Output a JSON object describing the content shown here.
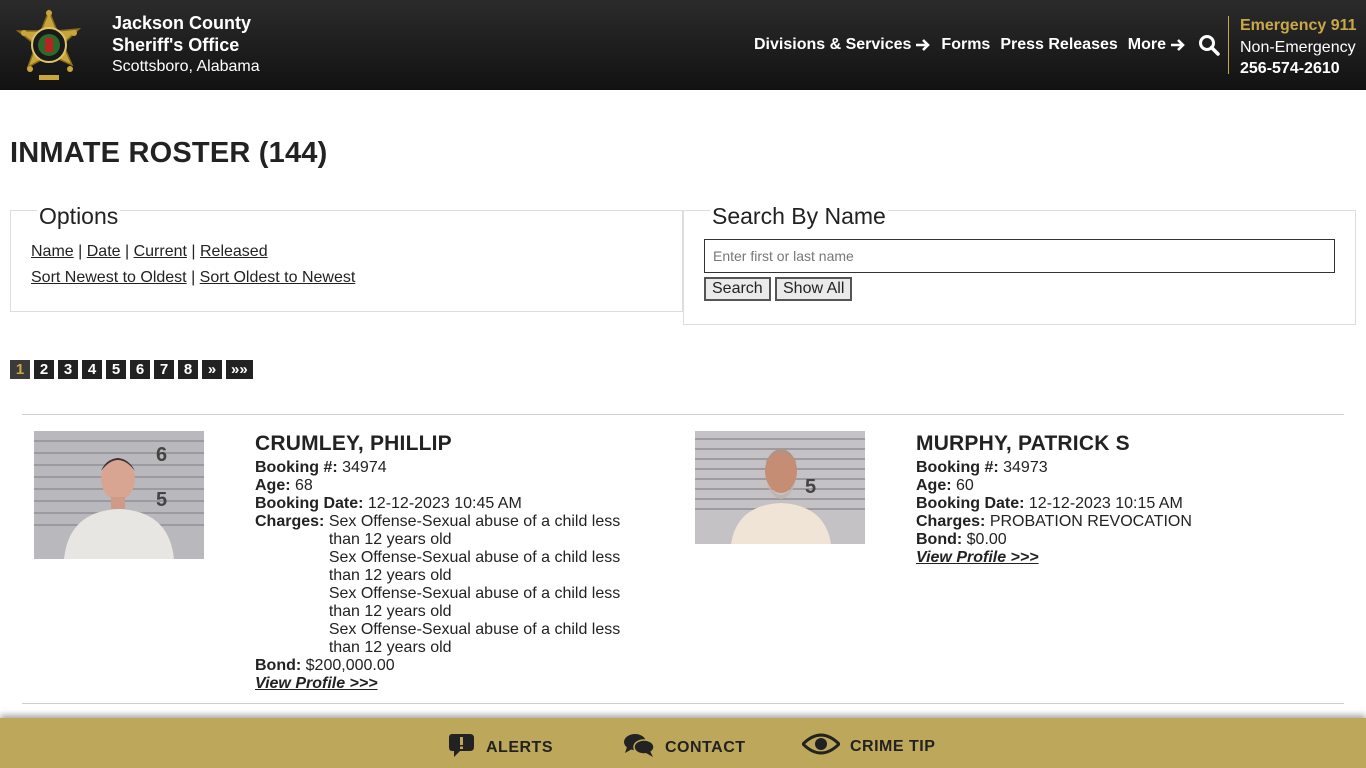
{
  "header": {
    "org_line1": "Jackson County",
    "org_line2": "Sheriff's Office",
    "location": "Scottsboro, Alabama",
    "nav": [
      {
        "label": "Divisions & Services",
        "icon": "arrow-right-icon"
      },
      {
        "label": "Forms"
      },
      {
        "label": "Press Releases"
      },
      {
        "label": "More",
        "icon": "arrow-right-icon"
      }
    ],
    "search_icon": "search-icon",
    "emergency_label": "Emergency 911",
    "non_emergency_label": "Non-Emergency",
    "non_emergency_phone": "256-574-2610",
    "accent_color": "#c9a84a"
  },
  "page": {
    "title": "INMATE ROSTER (144)"
  },
  "options": {
    "legend": "Options",
    "sort_links": [
      "Name",
      "Date",
      "Current",
      "Released"
    ],
    "order_links": [
      "Sort Newest to Oldest",
      "Sort Oldest to Newest"
    ]
  },
  "search": {
    "legend": "Search By Name",
    "placeholder": "Enter first or last name",
    "value": "",
    "search_button": "Search",
    "show_all_button": "Show All"
  },
  "pagination": {
    "pages": [
      "1",
      "2",
      "3",
      "4",
      "5",
      "6",
      "7",
      "8",
      "»",
      "»»"
    ],
    "current": "1"
  },
  "inmates": [
    {
      "name": "CRUMLEY, PHILLIP",
      "booking_label": "Booking #:",
      "booking_number": "34974",
      "age_label": "Age:",
      "age": "68",
      "booking_date_label": "Booking Date:",
      "booking_date": "12-12-2023 10:45 AM",
      "charges_label": "Charges:",
      "charges": [
        "Sex Offense-Sexual abuse of a child less than 12 years old",
        "Sex Offense-Sexual abuse of a child less than 12 years old",
        "Sex Offense-Sexual abuse of a child less than 12 years old",
        "Sex Offense-Sexual abuse of a child less than 12 years old"
      ],
      "bond_label": "Bond:",
      "bond": "$200,000.00",
      "profile_link": "View Profile >>>"
    },
    {
      "name": "MURPHY, PATRICK S",
      "booking_label": "Booking #:",
      "booking_number": "34973",
      "age_label": "Age:",
      "age": "60",
      "booking_date_label": "Booking Date:",
      "booking_date": "12-12-2023 10:15 AM",
      "charges_label": "Charges:",
      "charges": [
        "PROBATION REVOCATION"
      ],
      "bond_label": "Bond:",
      "bond": "$0.00",
      "profile_link": "View Profile >>>"
    }
  ],
  "footer": {
    "items": [
      {
        "label": "ALERTS",
        "icon": "alert-bubble-icon"
      },
      {
        "label": "CONTACT",
        "icon": "chat-bubbles-icon"
      },
      {
        "label": "CRIME TIP",
        "icon": "eye-icon"
      }
    ],
    "background_color": "#bca75b"
  }
}
